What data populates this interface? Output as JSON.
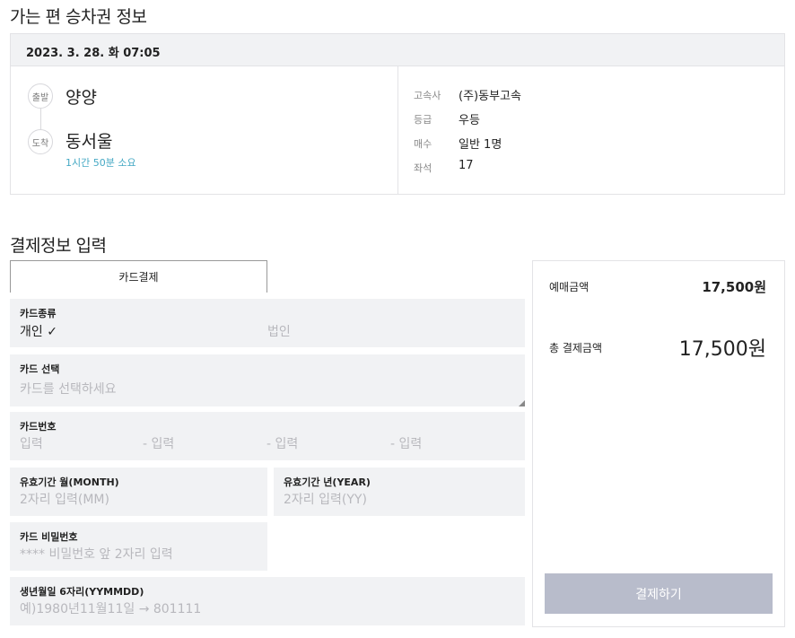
{
  "outbound": {
    "title": "가는 편 승차권 정보",
    "datetime": "2023. 3. 28. 화 07:05",
    "departure_badge": "출발",
    "departure_city": "양양",
    "arrival_badge": "도착",
    "arrival_city": "동서울",
    "duration": "1시간 50분 소요",
    "details": [
      {
        "label": "고속사",
        "value": "(주)동부고속"
      },
      {
        "label": "등급",
        "value": "우등"
      },
      {
        "label": "매수",
        "value": "일반 1명"
      },
      {
        "label": "좌석",
        "value": "17"
      }
    ]
  },
  "payment": {
    "title": "결제정보 입력",
    "tab_label": "카드결제",
    "card_type": {
      "label": "카드종류",
      "option_personal": "개인",
      "check_mark": "✓",
      "option_corporate": "법인"
    },
    "card_select": {
      "label": "카드 선택",
      "placeholder": "카드를 선택하세요"
    },
    "card_number": {
      "label": "카드번호",
      "parts": [
        "입력",
        "- 입력",
        "- 입력",
        "- 입력"
      ]
    },
    "expiry_month": {
      "label": "유효기간 월(MONTH)",
      "placeholder": "2자리 입력(MM)"
    },
    "expiry_year": {
      "label": "유효기간 년(YEAR)",
      "placeholder": "2자리 입력(YY)"
    },
    "password": {
      "label": "카드 비밀번호",
      "placeholder": "**** 비밀번호 앞 2자리 입력"
    },
    "birth": {
      "label": "생년월일 6자리(YYMMDD)",
      "placeholder": "예)1980년11월11일 → 801111"
    }
  },
  "summary": {
    "ticket_amount_label": "예매금액",
    "ticket_amount": "17,500원",
    "total_label": "총 결제금액",
    "total_amount": "17,500원",
    "pay_button": "결제하기",
    "button_color": "#b8bccb"
  }
}
